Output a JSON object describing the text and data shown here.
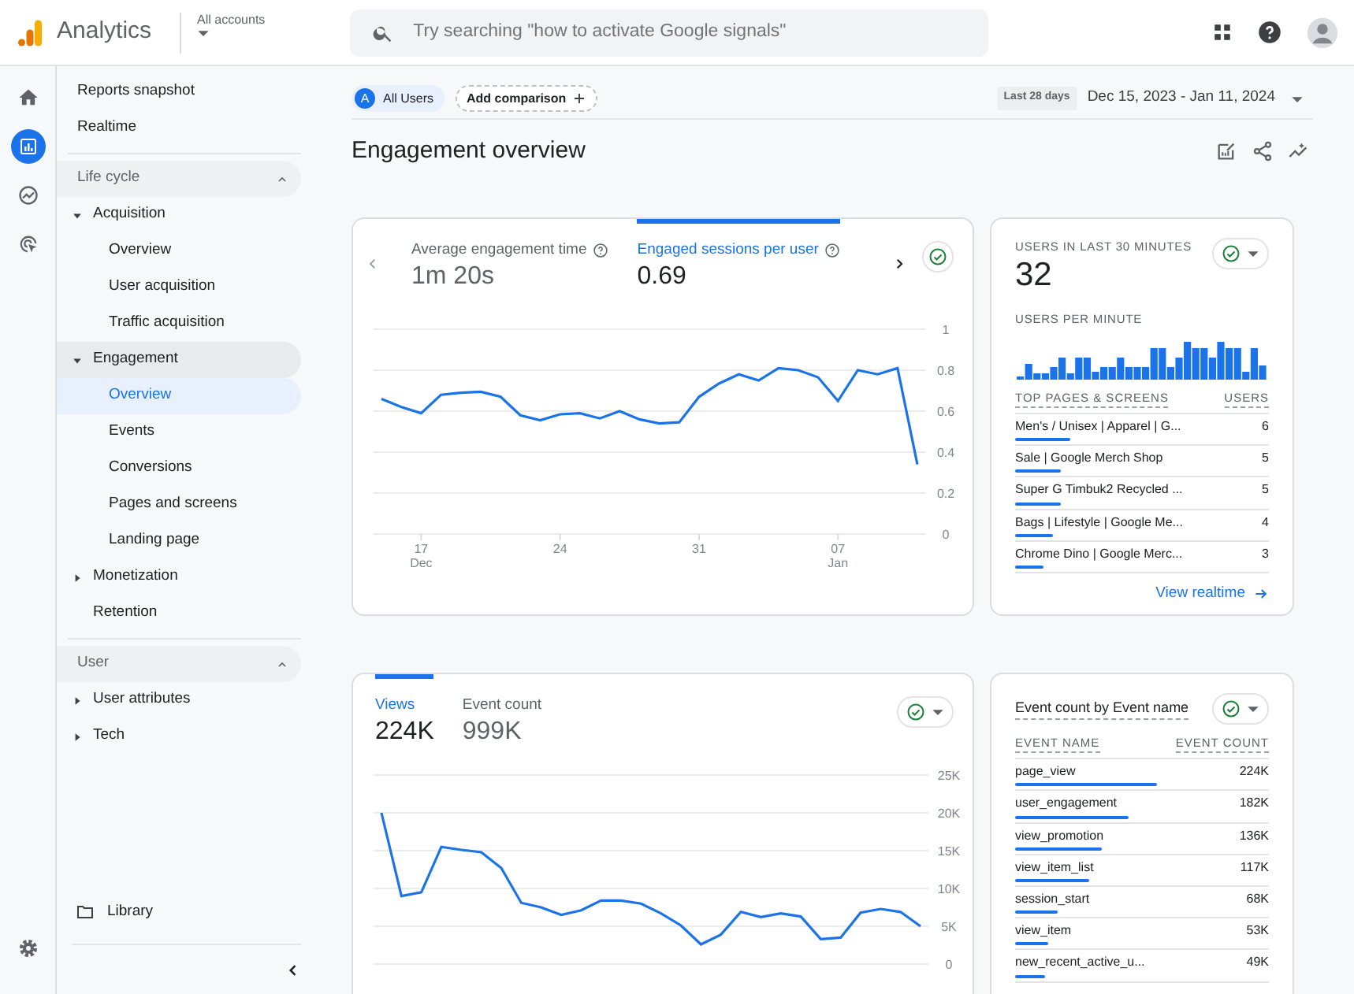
{
  "header": {
    "product": "Analytics",
    "account": "All accounts",
    "search_placeholder": "Try searching \"how to activate Google signals\""
  },
  "rail": [
    {
      "kind": "home",
      "selected": false
    },
    {
      "kind": "reports",
      "selected": true
    },
    {
      "kind": "explore",
      "selected": false
    },
    {
      "kind": "advertising",
      "selected": false
    }
  ],
  "nav": {
    "items": [
      {
        "kind": "link",
        "label": "Reports snapshot",
        "selected": false
      },
      {
        "kind": "link",
        "label": "Realtime",
        "selected": false
      },
      {
        "kind": "section",
        "label": "Life cycle",
        "expanded": true,
        "children": [
          {
            "kind": "group",
            "label": "Acquisition",
            "expanded": true,
            "children": [
              {
                "kind": "link",
                "label": "Overview",
                "selected": false
              },
              {
                "kind": "link",
                "label": "User acquisition",
                "selected": false
              },
              {
                "kind": "link",
                "label": "Traffic acquisition",
                "selected": false
              }
            ]
          },
          {
            "kind": "group",
            "label": "Engagement",
            "expanded": true,
            "children": [
              {
                "kind": "link",
                "label": "Overview",
                "selected": true
              },
              {
                "kind": "link",
                "label": "Events",
                "selected": false
              },
              {
                "kind": "link",
                "label": "Conversions",
                "selected": false
              },
              {
                "kind": "link",
                "label": "Pages and screens",
                "selected": false
              },
              {
                "kind": "link",
                "label": "Landing page",
                "selected": false
              }
            ]
          },
          {
            "kind": "group",
            "label": "Monetization",
            "expanded": false
          },
          {
            "kind": "link",
            "label": "Retention",
            "selected": false
          }
        ]
      },
      {
        "kind": "section",
        "label": "User",
        "expanded": true,
        "children": [
          {
            "kind": "group",
            "label": "User attributes",
            "expanded": false
          },
          {
            "kind": "group",
            "label": "Tech",
            "expanded": false
          }
        ]
      }
    ],
    "library": "Library"
  },
  "filters": {
    "segment_initial": "A",
    "segment": "All Users",
    "add_comparison": "Add comparison",
    "range_badge": "Last 28 days",
    "date_range": "Dec 15, 2023 - Jan 11, 2024"
  },
  "page_title": "Engagement overview",
  "engagement_card": {
    "metrics": [
      {
        "label": "Average engagement time",
        "value": "1m 20s",
        "selected": false
      },
      {
        "label": "Engaged sessions per user",
        "value": "0.69",
        "selected": true
      }
    ],
    "chart_data": {
      "type": "line",
      "grid": true,
      "ylim": [
        0,
        1
      ],
      "yticks": [
        0,
        0.2,
        0.4,
        0.6,
        0.8,
        1
      ],
      "categories": [
        null,
        null,
        "17 Dec",
        null,
        null,
        null,
        null,
        null,
        null,
        "24",
        null,
        null,
        null,
        null,
        null,
        null,
        "31",
        null,
        null,
        null,
        null,
        null,
        null,
        "07 Jan",
        null,
        null,
        null,
        null
      ],
      "series": [
        {
          "color": "#1a73e8",
          "values": [
            0.66,
            0.62,
            0.59,
            0.68,
            0.69,
            0.695,
            0.67,
            0.58,
            0.555,
            0.585,
            0.59,
            0.565,
            0.6,
            0.56,
            0.54,
            0.545,
            0.67,
            0.735,
            0.78,
            0.75,
            0.81,
            0.8,
            0.765,
            0.65,
            0.8,
            0.78,
            0.81,
            0.34
          ]
        }
      ]
    }
  },
  "realtime_card": {
    "title": "USERS IN LAST 30 MINUTES",
    "value": "32",
    "subtitle": "USERS PER MINUTE",
    "columns": [
      "TOP PAGES & SCREENS",
      "USERS"
    ],
    "rows": [
      {
        "page": "Men's / Unisex | Apparel | G...",
        "users": "6",
        "level": 0.22
      },
      {
        "page": "Sale | Google Merch Shop",
        "users": "5",
        "level": 0.18
      },
      {
        "page": "Super G Timbuk2 Recycled ...",
        "users": "5",
        "level": 0.18
      },
      {
        "page": "Bags | Lifestyle | Google Me...",
        "users": "4",
        "level": 0.15
      },
      {
        "page": "Chrome Dino | Google Merc...",
        "users": "3",
        "level": 0.11
      }
    ],
    "link": "View realtime"
  },
  "views_card": {
    "metrics": [
      {
        "label": "Views",
        "value": "224K",
        "selected": true
      },
      {
        "label": "Event count",
        "value": "999K",
        "selected": false
      }
    ],
    "chart_data": {
      "type": "line",
      "grid": true,
      "ylim": [
        0,
        25000
      ],
      "yticks": [
        0,
        {
          "value": 5000,
          "label": "5K"
        },
        {
          "value": 10000,
          "label": "10K"
        },
        {
          "value": 15000,
          "label": "15K"
        },
        {
          "value": 20000,
          "label": "20K"
        },
        {
          "value": 25000,
          "label": "25K"
        }
      ],
      "series": [
        {
          "color": "#1a73e8",
          "values": [
            20000,
            9000,
            9500,
            15500,
            15100,
            14800,
            12700,
            8100,
            7500,
            6500,
            7100,
            8400,
            8400,
            8000,
            6700,
            5100,
            2600,
            3900,
            6900,
            6200,
            6700,
            6300,
            3300,
            3500,
            6800,
            7300,
            6900,
            5000
          ]
        }
      ]
    }
  },
  "events_card": {
    "title": "Event count by Event name",
    "columns": [
      "EVENT NAME",
      "EVENT COUNT"
    ],
    "rows": [
      {
        "name": "page_view",
        "count": "224K",
        "level": 0.56
      },
      {
        "name": "user_engagement",
        "count": "182K",
        "level": 0.45
      },
      {
        "name": "view_promotion",
        "count": "136K",
        "level": 0.34
      },
      {
        "name": "view_item_list",
        "count": "117K",
        "level": 0.29
      },
      {
        "name": "session_start",
        "count": "68K",
        "level": 0.17
      },
      {
        "name": "view_item",
        "count": "53K",
        "level": 0.13
      },
      {
        "name": "new_recent_active_u...",
        "count": "49K",
        "level": 0.12
      }
    ]
  }
}
